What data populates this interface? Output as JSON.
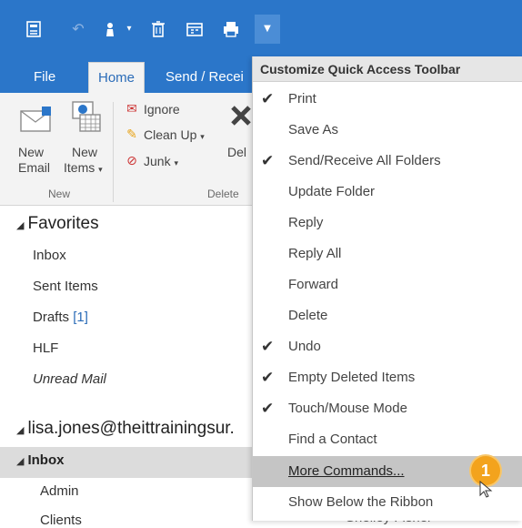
{
  "quick_access": {
    "icons": [
      "send-receive-icon",
      "undo-icon",
      "touch-mouse-icon",
      "empty-deleted-icon",
      "calendar-icon",
      "print-icon"
    ],
    "customize_icon": "customize-dropdown-icon"
  },
  "ribbon_tabs": [
    "File",
    "Home",
    "Send / Recei"
  ],
  "ribbon": {
    "new_email_line1": "New",
    "new_email_line2": "Email",
    "new_items_line1": "New",
    "new_items_line2": "Items",
    "group_new": "New",
    "ignore": "Ignore",
    "clean_up": "Clean Up",
    "junk": "Junk",
    "delete_partial": "Del",
    "group_delete": "Delete"
  },
  "folders": {
    "favorites": "Favorites",
    "favorites_items": [
      {
        "label": "Inbox"
      },
      {
        "label": "Sent Items"
      },
      {
        "label": "Drafts",
        "count": "[1]"
      },
      {
        "label": "HLF"
      },
      {
        "label": "Unread Mail"
      }
    ],
    "account": "lisa.jones@theittrainingsur.",
    "inbox": "Inbox",
    "inbox_children": [
      "Admin",
      "Clients"
    ]
  },
  "menu": {
    "header": "Customize Quick Access Toolbar",
    "items": [
      {
        "label": "Print",
        "checked": true
      },
      {
        "label": "Save As",
        "checked": false
      },
      {
        "label": "Send/Receive All Folders",
        "checked": true
      },
      {
        "label": "Update Folder",
        "checked": false
      },
      {
        "label": "Reply",
        "checked": false
      },
      {
        "label": "Reply All",
        "checked": false
      },
      {
        "label": "Forward",
        "checked": false
      },
      {
        "label": "Delete",
        "checked": false
      },
      {
        "label": "Undo",
        "checked": true
      },
      {
        "label": "Empty Deleted Items",
        "checked": true
      },
      {
        "label": "Touch/Mouse Mode",
        "checked": true
      },
      {
        "label": "Find a Contact",
        "checked": false
      },
      {
        "label": "More Commands...",
        "checked": false,
        "hover": true
      },
      {
        "label": "Show Below the Ribbon",
        "checked": false
      }
    ]
  },
  "annotation_badge": "1",
  "behind_text": "Shelley Fishel",
  "colors": {
    "ribbon_blue": "#2b76c9",
    "badge": "#f3a31d",
    "hover": "#c5c5c5"
  }
}
